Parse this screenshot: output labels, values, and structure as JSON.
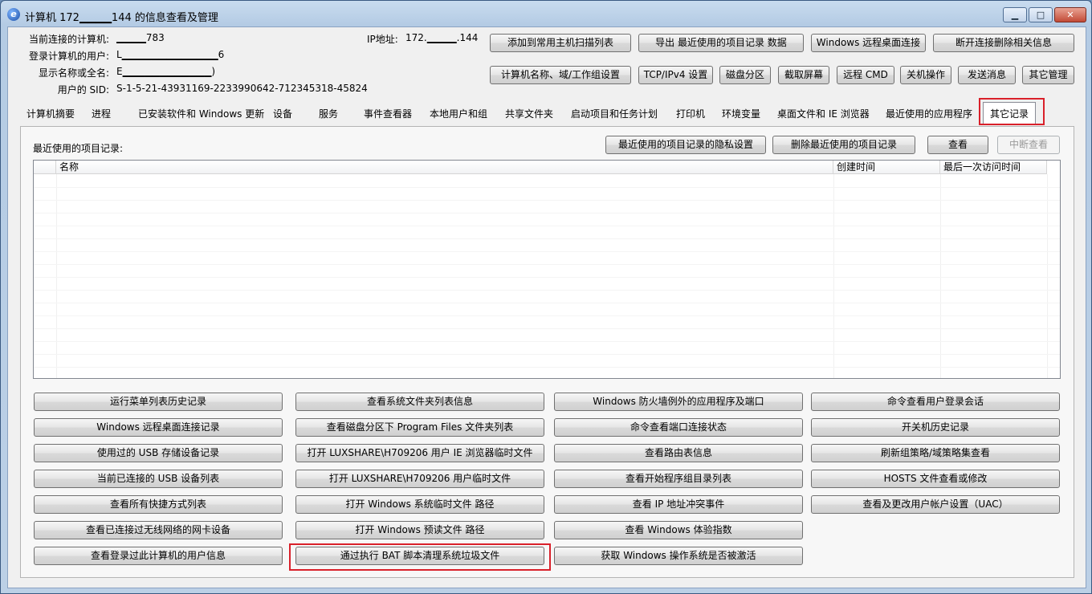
{
  "window": {
    "title": "计算机 172▁▁▁▁144 的信息查看及管理",
    "minimize_glyph": "▁",
    "maximize_glyph": "□",
    "close_glyph": "✕",
    "app_icon_glyph": "e"
  },
  "info": {
    "computer_label": "当前连接的计算机:",
    "computer_value": "▁▁▁▁783",
    "user_label": "登录计算机的用户:",
    "user_value": "L▁▁▁▁▁▁▁▁▁▁▁▁▁6",
    "display_label": "显示名称或全名:",
    "display_value": "E▁▁▁▁▁▁▁▁▁▁▁▁)",
    "sid_label": "用户的 SID:",
    "sid_value": "S-1-5-21-43931169-2233990642-712345318-45824",
    "ip_label": "IP地址:",
    "ip_value": "172.▁▁▁▁.144"
  },
  "toolbar": {
    "row1": [
      "添加到常用主机扫描列表",
      "导出 最近使用的项目记录 数据",
      "Windows 远程桌面连接",
      "断开连接删除相关信息"
    ],
    "row2": [
      "计算机名称、域/工作组设置",
      "TCP/IPv4 设置",
      "磁盘分区",
      "截取屏幕",
      "远程 CMD",
      "关机操作",
      "发送消息",
      "其它管理"
    ]
  },
  "tabs": [
    "计算机摘要",
    "进程",
    "已安装软件和 Windows 更新",
    "设备",
    "服务",
    "事件查看器",
    "本地用户和组",
    "共享文件夹",
    "启动项目和任务计划",
    "打印机",
    "环境变量",
    "桌面文件和 IE 浏览器",
    "最近使用的应用程序",
    "其它记录"
  ],
  "recent": {
    "label": "最近使用的项目记录:",
    "privacy_button": "最近使用的项目记录的隐私设置",
    "delete_button": "删除最近使用的项目记录",
    "view_button": "查看",
    "stop_button": "中断查看",
    "columns": [
      "名称",
      "创建时间",
      "最后一次访问时间"
    ]
  },
  "actions": {
    "col1": [
      "运行菜单列表历史记录",
      "Windows 远程桌面连接记录",
      "使用过的 USB 存储设备记录",
      "当前已连接的 USB 设备列表",
      "查看所有快捷方式列表",
      "查看已连接过无线网络的网卡设备",
      "查看登录过此计算机的用户信息"
    ],
    "col2": [
      "查看系统文件夹列表信息",
      "查看磁盘分区下 Program Files 文件夹列表",
      "打开 LUXSHARE\\H709206 用户 IE 浏览器临时文件",
      "打开 LUXSHARE\\H709206 用户临时文件",
      "打开 Windows 系统临时文件 路径",
      "打开 Windows 预读文件 路径",
      "通过执行 BAT 脚本清理系统垃圾文件"
    ],
    "col3": [
      "Windows 防火墙例外的应用程序及端口",
      "命令查看端口连接状态",
      "查看路由表信息",
      "查看开始程序组目录列表",
      "查看 IP 地址冲突事件",
      "查看 Windows 体验指数",
      "获取 Windows 操作系统是否被激活"
    ],
    "col4": [
      "命令查看用户登录会话",
      "开关机历史记录",
      "刷新组策略/域策略集查看",
      "HOSTS 文件查看或修改",
      "查看及更改用户帐户设置（UAC）"
    ]
  },
  "colors": {
    "highlight": "#d9202a"
  }
}
